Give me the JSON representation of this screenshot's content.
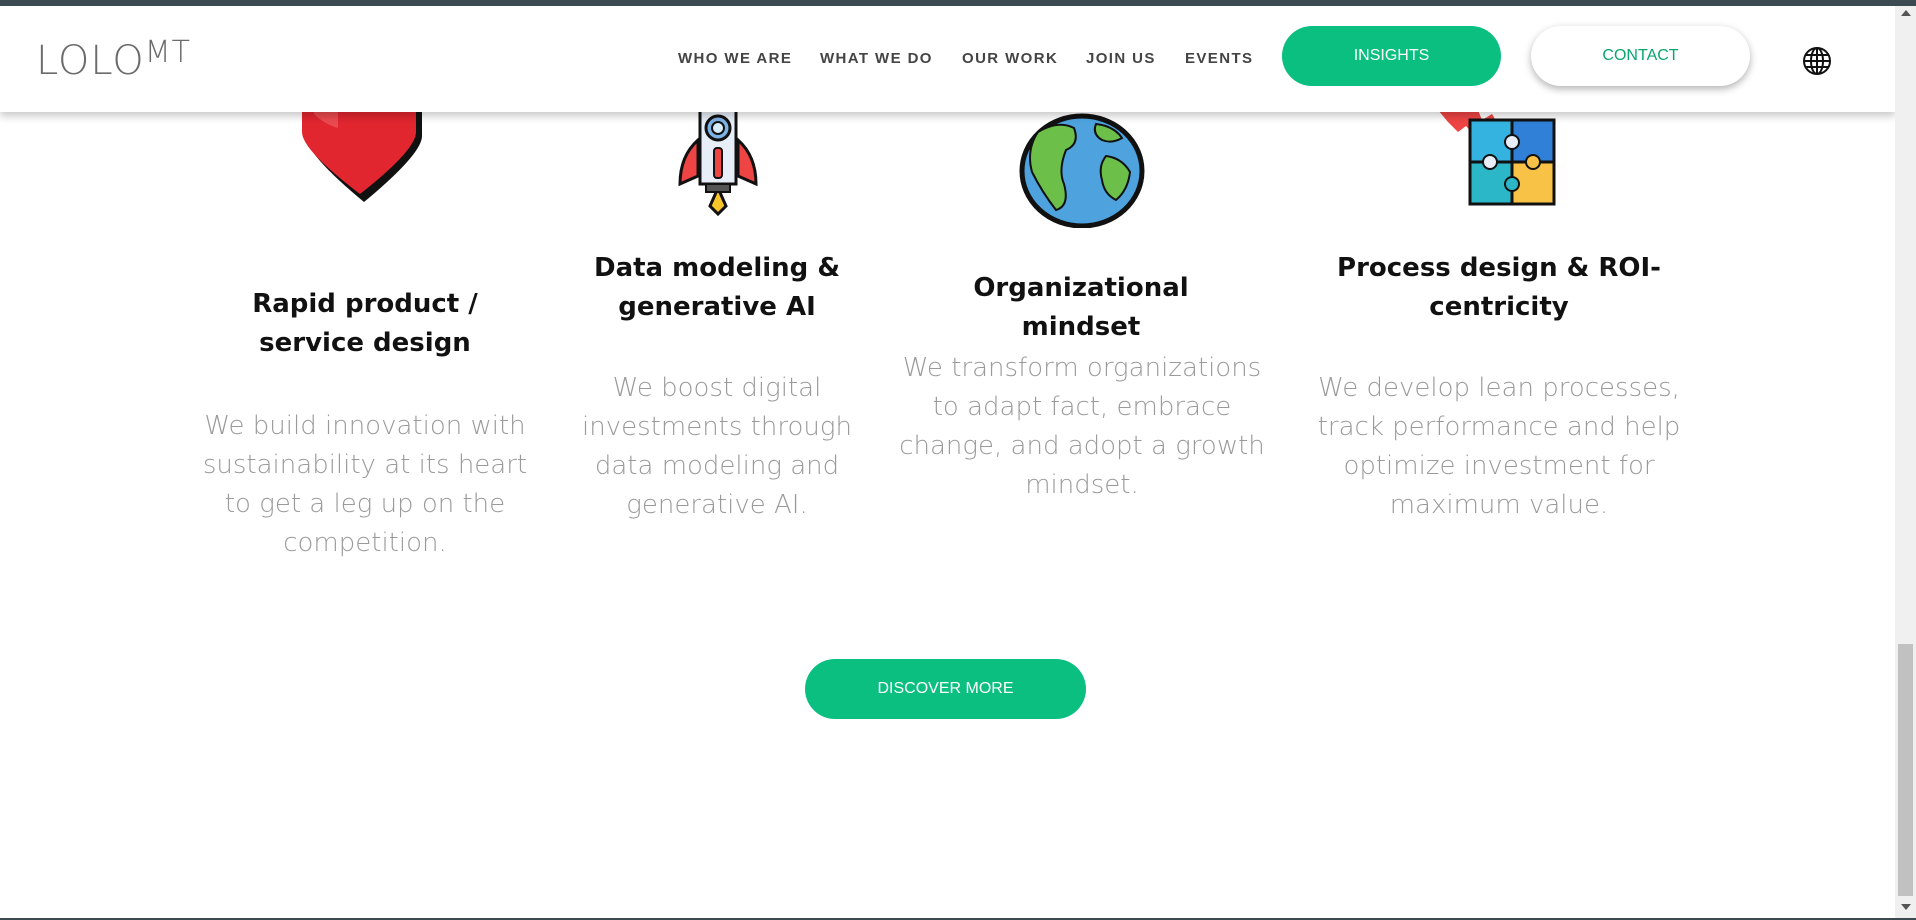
{
  "header": {
    "logo_main": "LOLO",
    "logo_sup": "MT",
    "nav": [
      "WHO WE ARE",
      "WHAT WE DO",
      "OUR WORK",
      "JOIN US",
      "EVENTS"
    ],
    "insights_label": "INSIGHTS",
    "contact_label": "CONTACT",
    "language_icon": "globe-icon"
  },
  "services": [
    {
      "icon": "heart-icon",
      "title": "Rapid product / service design",
      "description": "We build innovation with sustainability at its heart to get a leg up on the competition."
    },
    {
      "icon": "rocket-icon",
      "title": "Data modeling & generative AI",
      "description": "We boost digital investments through data modeling and generative AI."
    },
    {
      "icon": "earth-icon",
      "title": "Organizational mindset",
      "description": "We transform organizations to adapt fact, embrace change, and adopt a growth mindset."
    },
    {
      "icon": "puzzle-icon",
      "title": "Process design & ROI-centricity",
      "description": "We develop lean processes, track performance and help optimize investment for maximum value."
    }
  ],
  "cta": {
    "discover_label": "DISCOVER MORE"
  },
  "colors": {
    "accent": "#0bbf80",
    "heading": "#111111",
    "body_text": "#9a9a9a",
    "nav_text": "#444444"
  }
}
